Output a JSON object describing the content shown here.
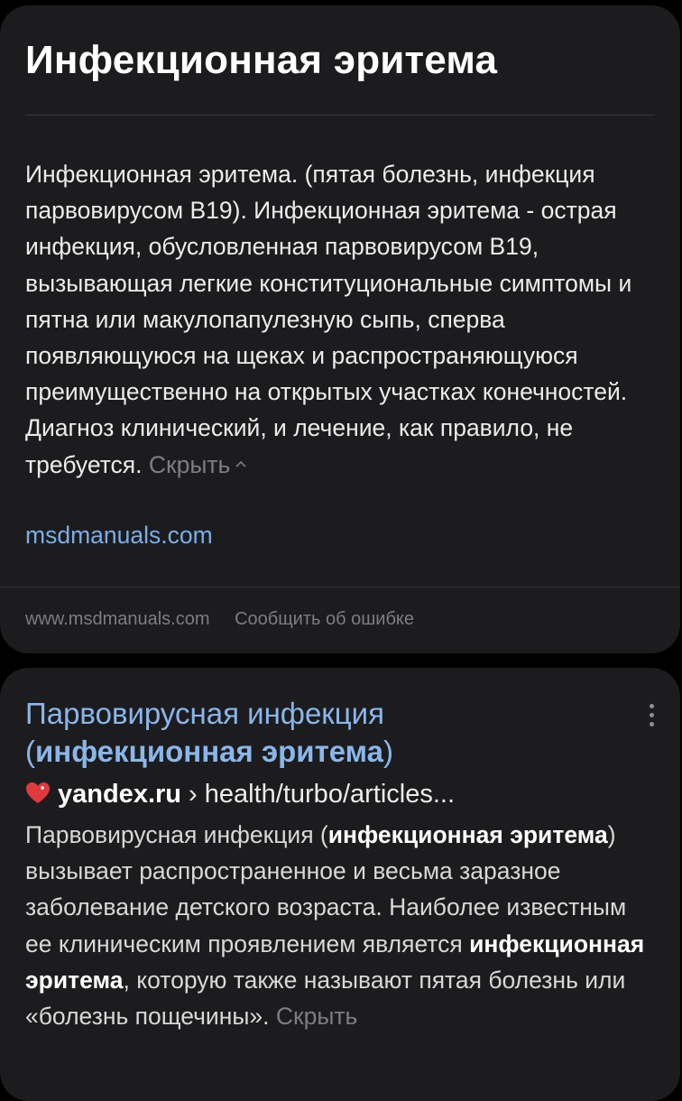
{
  "card1": {
    "title": "Инфекционная эритема",
    "body": "Инфекционная эритема. (пятая болезнь, инфекция парвовирусом B19). Инфекционная эритема - острая инфекция, обусловленная парвовирусом B19, вызывающая легкие конституциональные симптомы и пятна или макулопапулезную сыпь, сперва появляющуюся на щеках и распространяющуюся преимущественно на открытых участках конечностей. Диагноз клинический, и лечение, как правило, не требуется.",
    "hide_label": "Скрыть",
    "source_link": "msdmanuals.com",
    "footer_domain": "www.msdmanuals.com",
    "footer_report": "Сообщить об ошибке"
  },
  "card2": {
    "title_a": "Парвовирусная инфекция (",
    "title_b": "инфекционная эритема",
    "title_c": ")",
    "host": "yandex.ru",
    "path": " › health/turbo/articles...",
    "snippet_1": "Парвовирусная инфекция (",
    "snippet_2": "инфекционная эритема",
    "snippet_3": ") вызывает распространенное и весьма заразное заболевание детского возраста. Наиболее известным ее клиническим проявлением является ",
    "snippet_4": "инфекционная эритема",
    "snippet_5": ", которую также называют пятая болезнь или «болезнь пощечины».",
    "hide_label": "Скрыть"
  },
  "colors": {
    "background": "#000000",
    "card": "#1c1c1e",
    "link": "#7aaee8",
    "muted": "#7d7d82",
    "heart": "#e0393e"
  },
  "icons": [
    "chevron-up-icon",
    "kebab-menu-icon",
    "heart-icon"
  ]
}
